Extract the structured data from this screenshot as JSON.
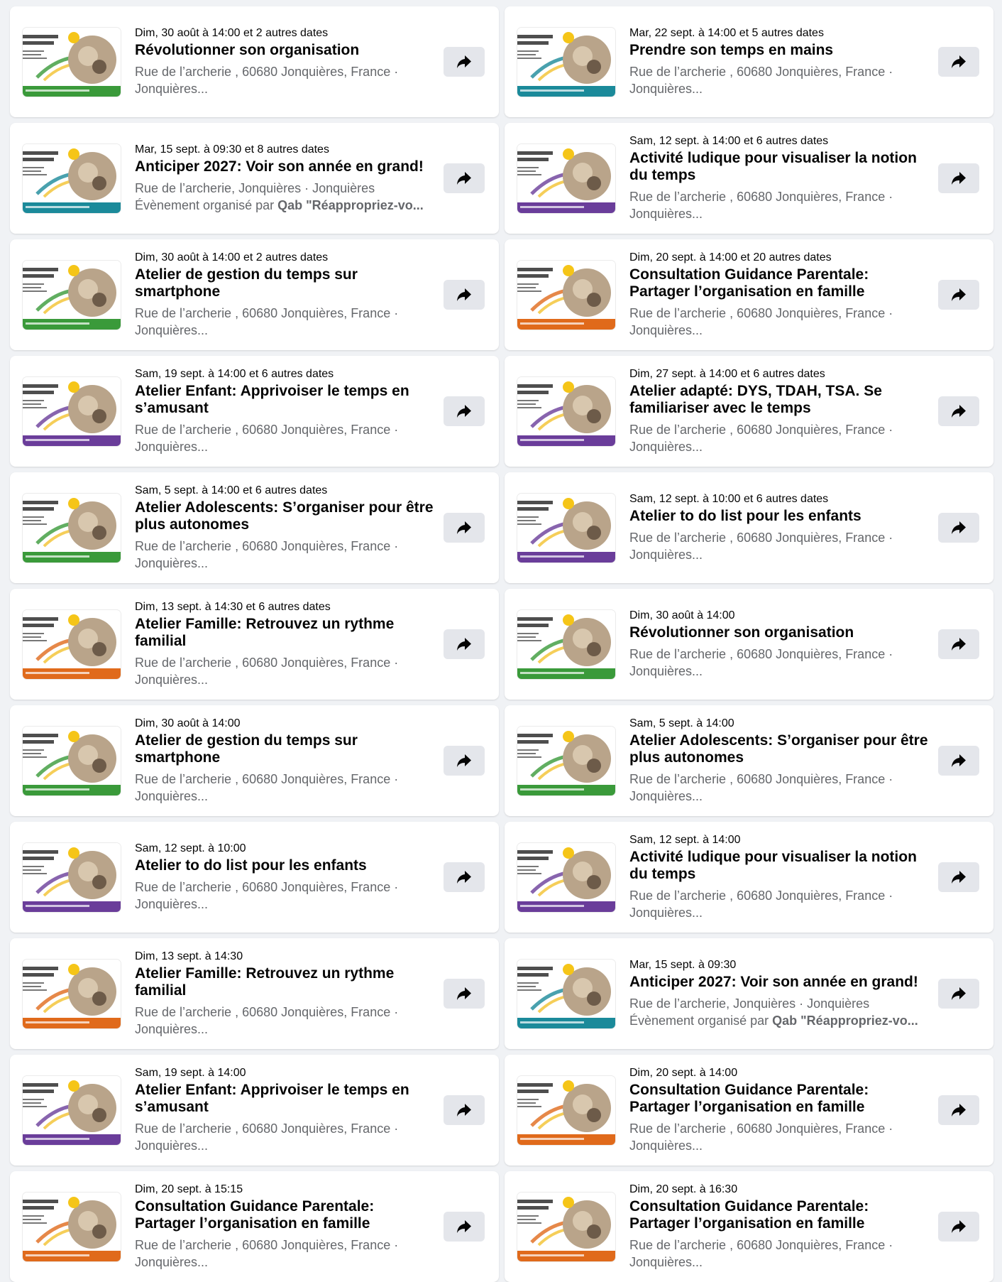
{
  "colors": {
    "page_bg": "#f0f2f5",
    "card_bg": "#ffffff",
    "secondary_text": "#65676b",
    "share_bg": "#e4e6eb"
  },
  "share_icon": "share-arrow-icon",
  "events": [
    {
      "date": "Dim, 30 août à 14:00 et 2 autres dates",
      "title": "Révolutionner son organisation",
      "location": "Rue de l’archerie , 60680 Jonquières, France · Jonquières...",
      "organizer_prefix": "",
      "organizer": "",
      "theme": "green"
    },
    {
      "date": "Mar, 22 sept. à 14:00 et 5 autres dates",
      "title": "Prendre son temps en mains",
      "location": "Rue de l’archerie , 60680 Jonquières, France · Jonquières...",
      "organizer_prefix": "",
      "organizer": "",
      "theme": "teal"
    },
    {
      "date": "Mar, 15 sept. à 09:30 et 8 autres dates",
      "title": "Anticiper 2027: Voir son année en grand!",
      "location": "Rue de l’archerie, Jonquières · Jonquières",
      "organizer_prefix": "Évènement organisé par",
      "organizer": "Qab \"Réappropriez-vo...",
      "theme": "teal"
    },
    {
      "date": "Sam, 12 sept. à 14:00 et 6 autres dates",
      "title": "Activité ludique pour visualiser la notion du temps",
      "location": "Rue de l’archerie , 60680 Jonquières, France · Jonquières...",
      "organizer_prefix": "",
      "organizer": "",
      "theme": "purple"
    },
    {
      "date": "Dim, 30 août à 14:00 et 2 autres dates",
      "title": "Atelier de gestion du temps sur smartphone",
      "location": "Rue de l’archerie , 60680 Jonquières, France · Jonquières...",
      "organizer_prefix": "",
      "organizer": "",
      "theme": "green"
    },
    {
      "date": "Dim, 20 sept. à 14:00 et 20 autres dates",
      "title": "Consultation Guidance Parentale: Partager l’organisation en famille",
      "location": "Rue de l’archerie , 60680 Jonquières, France · Jonquières...",
      "organizer_prefix": "",
      "organizer": "",
      "theme": "orange"
    },
    {
      "date": "Sam, 19 sept. à 14:00 et 6 autres dates",
      "title": "Atelier Enfant: Apprivoiser le temps en s’amusant",
      "location": "Rue de l’archerie , 60680 Jonquières, France · Jonquières...",
      "organizer_prefix": "",
      "organizer": "",
      "theme": "purple"
    },
    {
      "date": "Dim, 27 sept. à 14:00 et 6 autres dates",
      "title": "Atelier adapté: DYS, TDAH, TSA. Se familiariser avec le temps",
      "location": "Rue de l’archerie , 60680 Jonquières, France · Jonquières...",
      "organizer_prefix": "",
      "organizer": "",
      "theme": "purple"
    },
    {
      "date": "Sam, 5 sept. à 14:00 et 6 autres dates",
      "title": "Atelier Adolescents: S’organiser pour être plus autonomes",
      "location": "Rue de l’archerie , 60680 Jonquières, France · Jonquières...",
      "organizer_prefix": "",
      "organizer": "",
      "theme": "green"
    },
    {
      "date": "Sam, 12 sept. à 10:00 et 6 autres dates",
      "title": "Atelier to do list pour les enfants",
      "location": "Rue de l’archerie , 60680 Jonquières, France · Jonquières...",
      "organizer_prefix": "",
      "organizer": "",
      "theme": "purple"
    },
    {
      "date": "Dim, 13 sept. à 14:30 et 6 autres dates",
      "title": "Atelier Famille: Retrouvez un rythme familial",
      "location": "Rue de l’archerie , 60680 Jonquières, France · Jonquières...",
      "organizer_prefix": "",
      "organizer": "",
      "theme": "orange"
    },
    {
      "date": "Dim, 30 août à 14:00",
      "title": "Révolutionner son organisation",
      "location": "Rue de l’archerie , 60680 Jonquières, France · Jonquières...",
      "organizer_prefix": "",
      "organizer": "",
      "theme": "green"
    },
    {
      "date": "Dim, 30 août à 14:00",
      "title": "Atelier de gestion du temps sur smartphone",
      "location": "Rue de l’archerie , 60680 Jonquières, France · Jonquières...",
      "organizer_prefix": "",
      "organizer": "",
      "theme": "green"
    },
    {
      "date": "Sam, 5 sept. à 14:00",
      "title": "Atelier Adolescents: S’organiser pour être plus autonomes",
      "location": "Rue de l’archerie , 60680 Jonquières, France · Jonquières...",
      "organizer_prefix": "",
      "organizer": "",
      "theme": "green"
    },
    {
      "date": "Sam, 12 sept. à 10:00",
      "title": "Atelier to do list pour les enfants",
      "location": "Rue de l’archerie , 60680 Jonquières, France · Jonquières...",
      "organizer_prefix": "",
      "organizer": "",
      "theme": "purple"
    },
    {
      "date": "Sam, 12 sept. à 14:00",
      "title": "Activité ludique pour visualiser la notion du temps",
      "location": "Rue de l’archerie , 60680 Jonquières, France · Jonquières...",
      "organizer_prefix": "",
      "organizer": "",
      "theme": "purple"
    },
    {
      "date": "Dim, 13 sept. à 14:30",
      "title": "Atelier Famille: Retrouvez un rythme familial",
      "location": "Rue de l’archerie , 60680 Jonquières, France · Jonquières...",
      "organizer_prefix": "",
      "organizer": "",
      "theme": "orange"
    },
    {
      "date": "Mar, 15 sept. à 09:30",
      "title": "Anticiper 2027: Voir son année en grand!",
      "location": "Rue de l’archerie, Jonquières · Jonquières",
      "organizer_prefix": "Évènement organisé par",
      "organizer": "Qab \"Réappropriez-vo...",
      "theme": "teal"
    },
    {
      "date": "Sam, 19 sept. à 14:00",
      "title": "Atelier Enfant: Apprivoiser le temps en s’amusant",
      "location": "Rue de l’archerie , 60680 Jonquières, France · Jonquières...",
      "organizer_prefix": "",
      "organizer": "",
      "theme": "purple"
    },
    {
      "date": "Dim, 20 sept. à 14:00",
      "title": "Consultation Guidance Parentale: Partager l’organisation en famille",
      "location": "Rue de l’archerie , 60680 Jonquières, France · Jonquières...",
      "organizer_prefix": "",
      "organizer": "",
      "theme": "orange"
    },
    {
      "date": "Dim, 20 sept. à 15:15",
      "title": "Consultation Guidance Parentale: Partager l’organisation en famille",
      "location": "Rue de l’archerie , 60680 Jonquières, France · Jonquières...",
      "organizer_prefix": "",
      "organizer": "",
      "theme": "orange"
    },
    {
      "date": "Dim, 20 sept. à 16:30",
      "title": "Consultation Guidance Parentale: Partager l’organisation en famille",
      "location": "Rue de l’archerie , 60680 Jonquières, France · Jonquières...",
      "organizer_prefix": "",
      "organizer": "",
      "theme": "orange"
    }
  ],
  "themes": {
    "green": "#3a9a3a",
    "teal": "#1b8a9a",
    "purple": "#6a3d9a",
    "orange": "#e06a1b"
  }
}
